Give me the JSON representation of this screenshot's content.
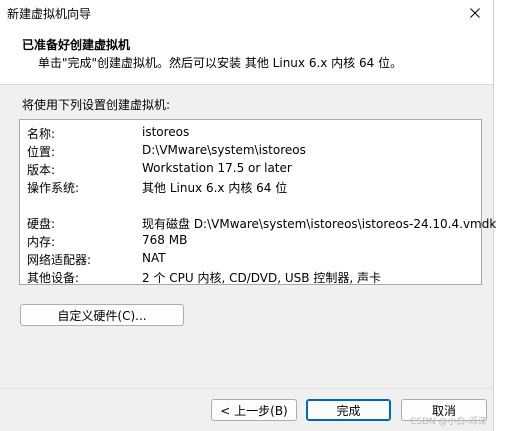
{
  "window": {
    "title": "新建虚拟机向导"
  },
  "header": {
    "title": "已准备好创建虚拟机",
    "subtitle": "单击\"完成\"创建虚拟机。然后可以安装 其他 Linux 6.x 内核 64 位。"
  },
  "section_label": "将使用下列设置创建虚拟机:",
  "summary": [
    {
      "label": "名称:",
      "value": "istoreos"
    },
    {
      "label": "位置:",
      "value": "D:\\VMware\\system\\istoreos"
    },
    {
      "label": "版本:",
      "value": "Workstation 17.5 or later"
    },
    {
      "label": "操作系统:",
      "value": "其他 Linux 6.x 内核 64 位"
    },
    {
      "label": "硬盘:",
      "value": "现有磁盘 D:\\VMware\\system\\istoreos\\istoreos-24.10.4.vmdk"
    },
    {
      "label": "内存:",
      "value": "768 MB"
    },
    {
      "label": "网络适配器:",
      "value": "NAT"
    },
    {
      "label": "其他设备:",
      "value": "2 个 CPU 内核, CD/DVD, USB 控制器, 声卡"
    }
  ],
  "buttons": {
    "customize": "自定义硬件(C)...",
    "back": "< 上一步(B)",
    "finish": "完成",
    "cancel": "取消"
  },
  "watermark": "CSDN @小白-邓涞"
}
